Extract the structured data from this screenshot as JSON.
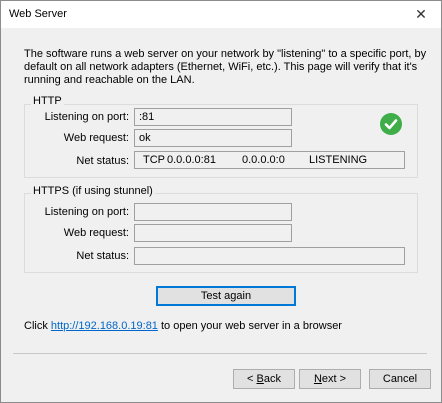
{
  "window": {
    "title": "Web Server",
    "close_glyph": "✕"
  },
  "intro_text": "The software runs a web server on your network by \"listening\" to a specific port, by default on all network adapters (Ethernet, WiFi, etc.).  This page will verify that it's running and reachable on the LAN.",
  "http": {
    "group_label": "HTTP",
    "listening_label": "Listening on port:",
    "listening_value": ":81",
    "request_label": "Web request:",
    "request_value": "ok",
    "status_label": "Net status:",
    "status": {
      "proto": "TCP",
      "local": "0.0.0.0:81",
      "remote": "0.0.0.0:0",
      "state": "LISTENING"
    },
    "status_icon": "check-circle-icon",
    "status_color": "#3fae49"
  },
  "https": {
    "group_label": "HTTPS (if using stunnel)",
    "listening_label": "Listening on port:",
    "listening_value": "",
    "request_label": "Web request:",
    "request_value": "",
    "status_label": "Net status:",
    "status_value": ""
  },
  "test_button": "Test again",
  "link_line": {
    "prefix": "Click ",
    "url": "http://192.168.0.19:81",
    "suffix": " to open your web server in a browser"
  },
  "footer": {
    "back": {
      "pre": "< ",
      "accel": "B",
      "post": "ack"
    },
    "next": {
      "accel": "N",
      "post": "ext >"
    },
    "cancel": "Cancel"
  }
}
